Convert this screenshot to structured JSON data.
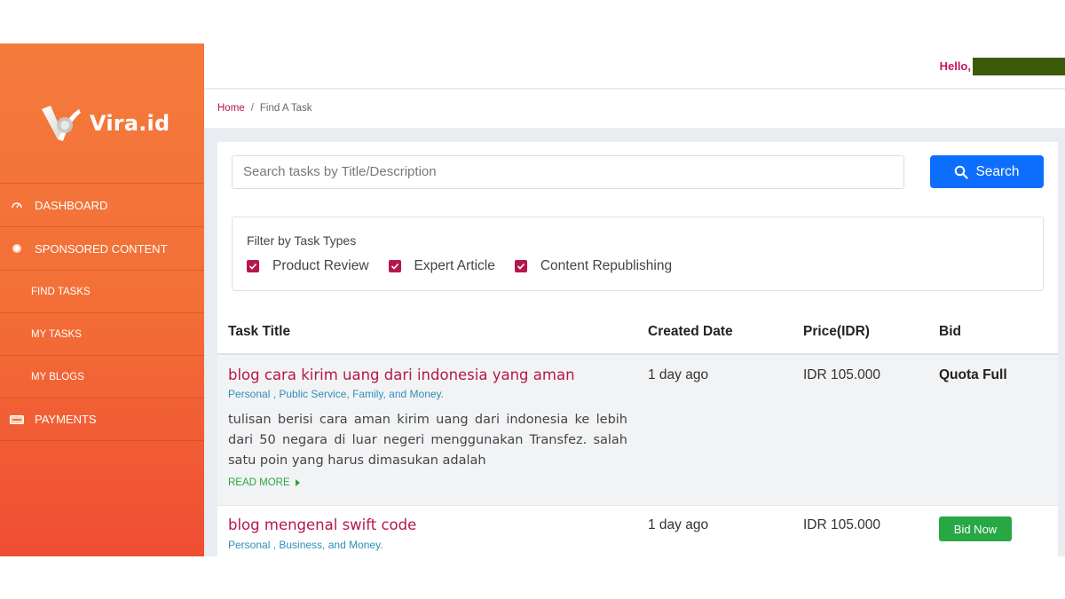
{
  "brand": {
    "name": "Vira.id"
  },
  "sidebar": {
    "items": [
      {
        "label": "DASHBOARD",
        "icon": "dashboard-icon"
      },
      {
        "label": "SPONSORED CONTENT",
        "icon": "bullet-icon"
      },
      {
        "label": "FIND TASKS"
      },
      {
        "label": "MY TASKS"
      },
      {
        "label": "MY BLOGS"
      },
      {
        "label": "PAYMENTS",
        "icon": "payments-icon"
      }
    ]
  },
  "topbar": {
    "greeting": "Hello,"
  },
  "breadcrumb": {
    "home": "Home",
    "separator": "/",
    "current": "Find A Task"
  },
  "search": {
    "placeholder": "Search tasks by Title/Description",
    "button_label": "Search"
  },
  "filter": {
    "title": "Filter by Task Types",
    "options": [
      {
        "label": "Product Review",
        "checked": true
      },
      {
        "label": "Expert Article",
        "checked": true
      },
      {
        "label": "Content Republishing",
        "checked": true
      }
    ]
  },
  "table": {
    "headers": [
      "Task Title",
      "Created Date",
      "Price(IDR)",
      "Bid"
    ],
    "rows": [
      {
        "title": "blog cara kirim uang dari indonesia yang aman",
        "categories": "Personal , Public Service, Family, and Money.",
        "description": "tulisan berisi cara aman kirim uang dari indonesia ke lebih dari 50 negara di luar negeri menggunakan Transfez. salah satu poin yang harus dimasukan adalah",
        "read_more": "READ MORE",
        "created": "1 day ago",
        "price": "IDR 105.000",
        "bid": "Quota Full"
      },
      {
        "title": "blog mengenal swift code",
        "categories": "Personal , Business, and Money.",
        "created": "1 day ago",
        "price": "IDR 105.000",
        "bid": "Bid Now"
      }
    ]
  },
  "colors": {
    "accent": "#b5174b",
    "sidebar_top": "#f47a3c",
    "sidebar_bottom": "#ef4d33",
    "primary": "#0d6efd",
    "success": "#28a745"
  }
}
